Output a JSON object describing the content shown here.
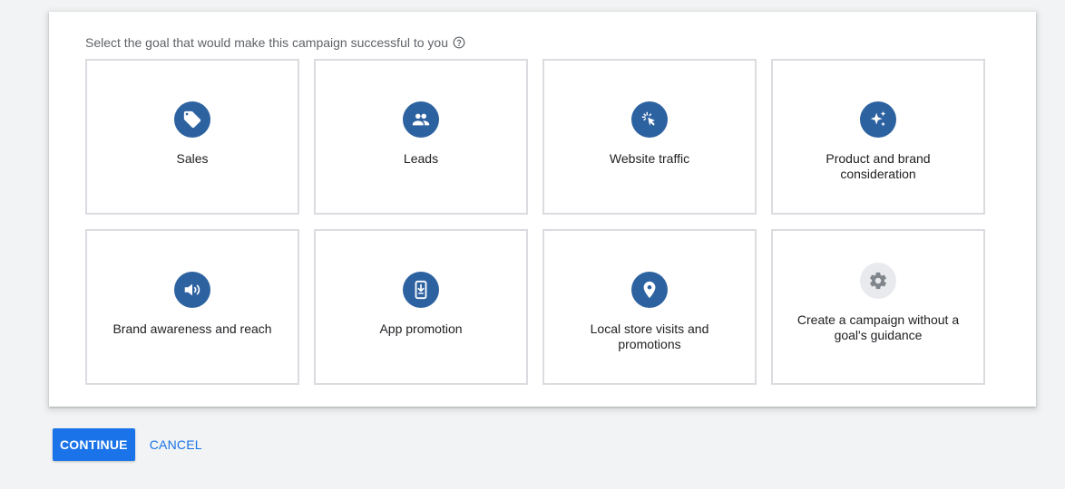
{
  "prompt": {
    "text": "Select the goal that would make this campaign successful to you",
    "help_icon": "help-circle-icon"
  },
  "goals": [
    {
      "label": "Sales",
      "icon": "tag-icon"
    },
    {
      "label": "Leads",
      "icon": "people-icon"
    },
    {
      "label": "Website traffic",
      "icon": "cursor-click-icon"
    },
    {
      "label": "Product and brand consideration",
      "icon": "sparkle-icon"
    },
    {
      "label": "Brand awareness and reach",
      "icon": "speaker-icon"
    },
    {
      "label": "App promotion",
      "icon": "phone-download-icon"
    },
    {
      "label": "Local store visits and promotions",
      "icon": "location-pin-icon"
    },
    {
      "label": "Create a campaign without a goal's guidance",
      "icon": "gear-icon"
    }
  ],
  "actions": {
    "continue_label": "CONTINUE",
    "cancel_label": "CANCEL"
  },
  "colors": {
    "accent": "#1a73e8",
    "icon_circle": "#2d62a1",
    "icon_circle_neutral": "#e8eaed",
    "tile_border": "#dadce0",
    "background": "#f1f3f4"
  }
}
